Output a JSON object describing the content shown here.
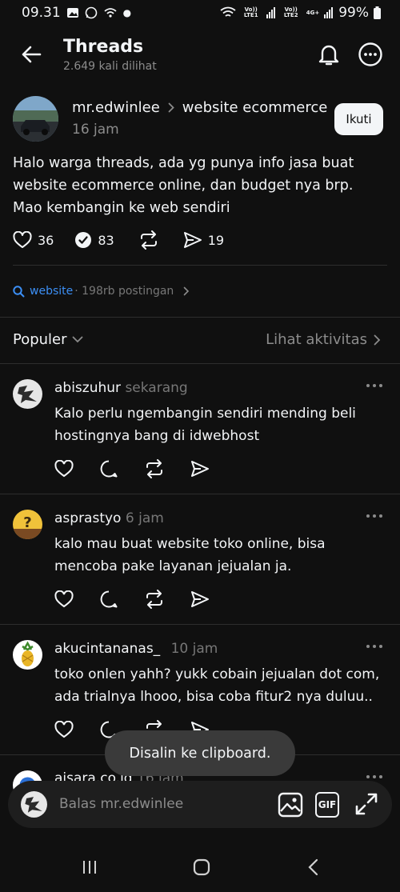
{
  "status_bar": {
    "time": "09.31",
    "sim1_label": "Vo)) LTE1",
    "sim2_label": "Vo)) LTE2",
    "network": "4G+",
    "battery": "99%"
  },
  "header": {
    "title": "Threads",
    "subtitle": "2.649 kali dilihat"
  },
  "post": {
    "username": "mr.edwinlee",
    "community": "website ecommerce",
    "time": "16 jam",
    "follow_label": "Ikuti",
    "body_lines": [
      "Halo warga threads, ada yg punya info jasa buat",
      "website ecommerce online, dan budget nya brp.",
      "Mao kembangin ke web sendiri"
    ],
    "likes": "36",
    "replies": "83",
    "shares": "19"
  },
  "topic": {
    "tag": "website",
    "count": "· 198rb postingan"
  },
  "sort": {
    "label": "Populer",
    "activity_link": "Lihat aktivitas"
  },
  "replies": [
    {
      "username": "abiszuhur",
      "time": "sekarang",
      "lines": [
        "Kalo perlu ngembangin sendiri mending beli",
        "hostingnya bang di idwebhost"
      ]
    },
    {
      "username": "asprastyo",
      "time": "6 jam",
      "lines": [
        "kalo mau buat website toko online, bisa",
        "mencoba pake layanan jejualan ja."
      ]
    },
    {
      "username": "akucintananas_",
      "time": "10 jam",
      "lines": [
        "toko onlen yahh? yukk cobain jejualan dot com,",
        "ada trialnya lhooo, bisa coba fitur2 nya duluu.."
      ]
    },
    {
      "username": "aisara.co.id",
      "time": "16 jam",
      "lines": []
    }
  ],
  "toast": "Disalin ke clipboard.",
  "composer": {
    "placeholder": "Balas mr.edwinlee",
    "gif_label": "GIF"
  },
  "colors": {
    "background": "#101010",
    "text": "#f3f5f7",
    "muted": "#777777",
    "accent": "#3c8ff5"
  }
}
